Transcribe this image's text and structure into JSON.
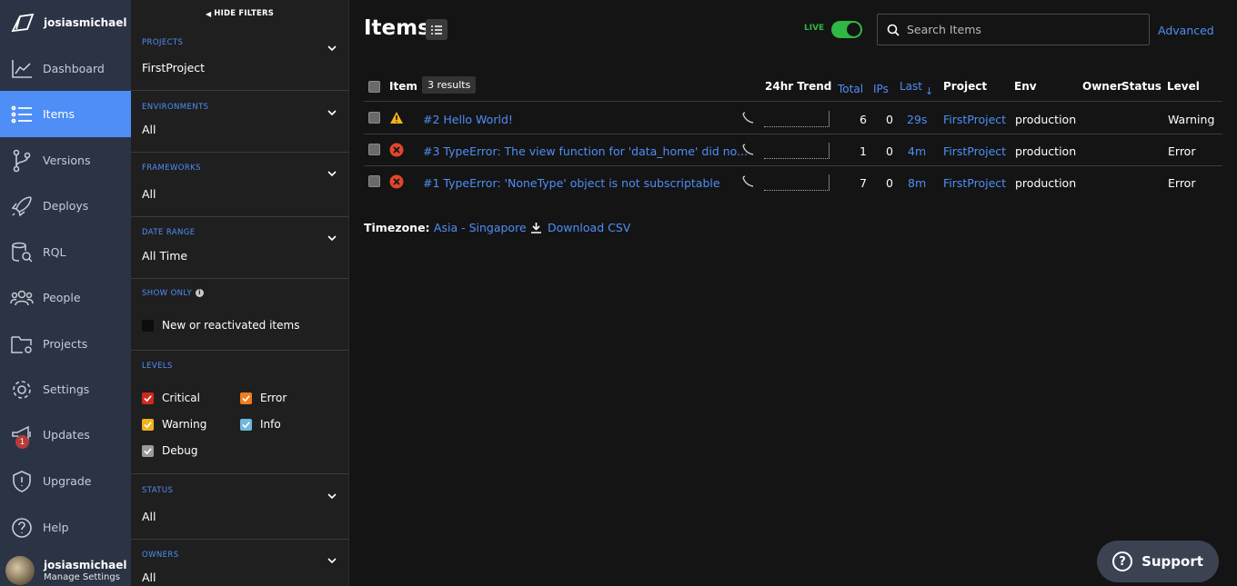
{
  "nav": {
    "brand": "josiasmichael",
    "items": [
      {
        "label": "Dashboard",
        "icon": "chart-line-icon"
      },
      {
        "label": "Items",
        "icon": "list-icon",
        "active": true
      },
      {
        "label": "Versions",
        "icon": "branch-icon"
      },
      {
        "label": "Deploys",
        "icon": "rocket-icon"
      },
      {
        "label": "RQL",
        "icon": "database-search-icon"
      },
      {
        "label": "People",
        "icon": "people-icon"
      },
      {
        "label": "Projects",
        "icon": "folder-gear-icon"
      },
      {
        "label": "Settings",
        "icon": "gear-icon"
      },
      {
        "label": "Updates",
        "icon": "megaphone-icon",
        "badge": "1"
      },
      {
        "label": "Upgrade",
        "icon": "shield-icon"
      },
      {
        "label": "Help",
        "icon": "help-icon"
      }
    ],
    "user": {
      "name": "josiasmichael",
      "sub": "Manage Settings"
    }
  },
  "filters": {
    "hide_label": "HIDE FILTERS",
    "projects": {
      "title": "PROJECTS",
      "value": "FirstProject"
    },
    "environments": {
      "title": "ENVIRONMENTS",
      "value": "All"
    },
    "frameworks": {
      "title": "FRAMEWORKS",
      "value": "All"
    },
    "date_range": {
      "title": "DATE RANGE",
      "value": "All Time"
    },
    "show_only": {
      "title": "SHOW ONLY",
      "option": "New or reactivated items"
    },
    "levels": {
      "title": "LEVELS",
      "options": [
        {
          "label": "Critical",
          "color": "#d0281f",
          "checked": true
        },
        {
          "label": "Error",
          "color": "#f07d1e",
          "checked": true
        },
        {
          "label": "Warning",
          "color": "#f2b21c",
          "checked": true
        },
        {
          "label": "Info",
          "color": "#6fb7e0",
          "checked": true
        },
        {
          "label": "Debug",
          "color": "#9a9a9a",
          "checked": true
        }
      ]
    },
    "status": {
      "title": "STATUS",
      "value": "All"
    },
    "owners": {
      "title": "OWNERS",
      "value": "All"
    }
  },
  "main": {
    "title": "Items",
    "live_label": "LIVE",
    "search_placeholder": "Search Items",
    "advanced_label": "Advanced",
    "results": "3 results",
    "columns": {
      "item": "Item",
      "trend": "24hr Trend",
      "total": "Total",
      "ips": "IPs",
      "last": "Last",
      "project": "Project",
      "env": "Env",
      "owner": "Owner",
      "status": "Status",
      "level": "Level"
    },
    "rows": [
      {
        "level_icon": "warning-icon",
        "title": "#2 Hello World!",
        "total": "6",
        "ips": "0",
        "last": "29s",
        "project": "FirstProject",
        "env": "production",
        "level": "Warning"
      },
      {
        "level_icon": "error-icon",
        "title": "#3 TypeError: The view function for 'data_home' did no...",
        "total": "1",
        "ips": "0",
        "last": "4m",
        "project": "FirstProject",
        "env": "production",
        "level": "Error"
      },
      {
        "level_icon": "error-icon",
        "title": "#1 TypeError: 'NoneType' object is not subscriptable",
        "total": "7",
        "ips": "0",
        "last": "8m",
        "project": "FirstProject",
        "env": "production",
        "level": "Error"
      }
    ],
    "timezone_label": "Timezone:",
    "timezone_value": "Asia - Singapore",
    "download_label": "Download CSV",
    "support_label": "Support"
  },
  "colors": {
    "accent": "#4f8ef7",
    "live": "#2fb844",
    "nav_bg": "#2b3444"
  }
}
